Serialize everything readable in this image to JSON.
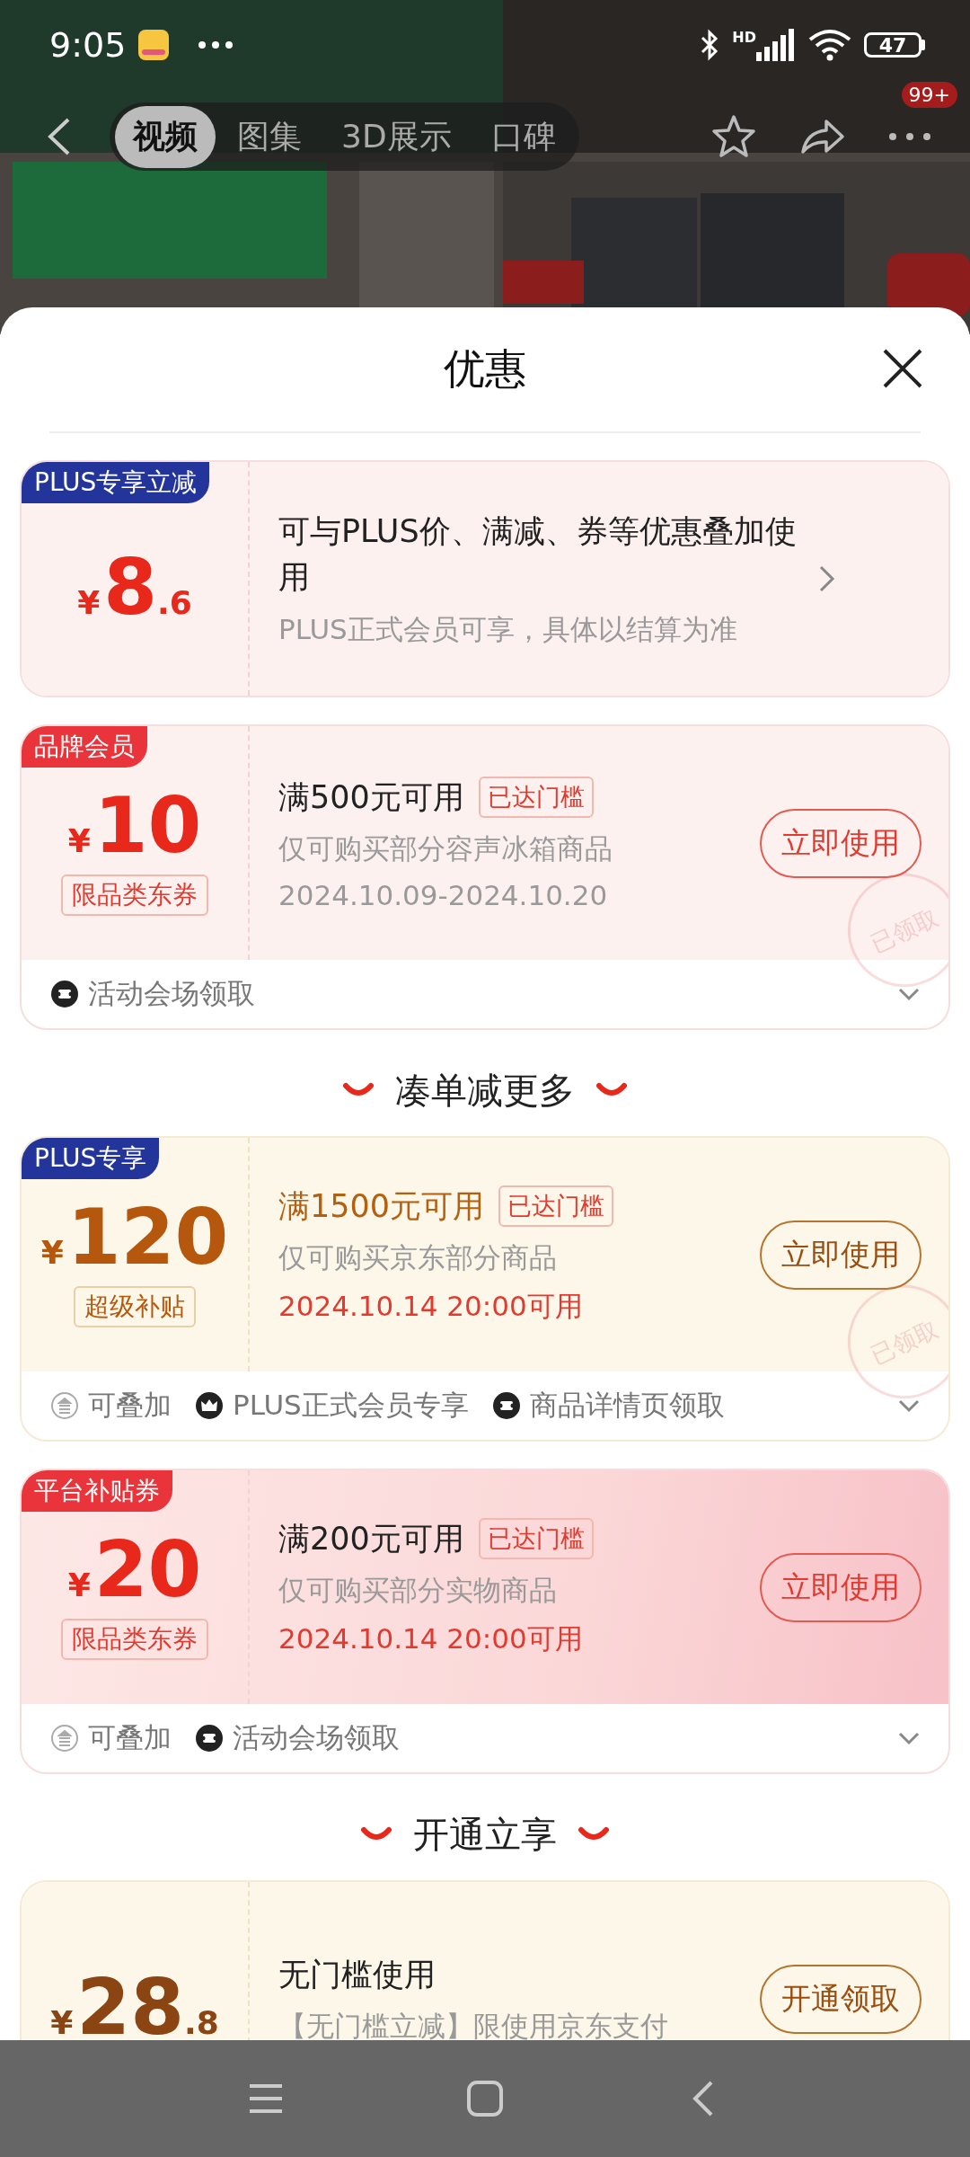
{
  "status_bar": {
    "time": "9:05",
    "network": "HD",
    "battery": "47"
  },
  "top_nav": {
    "tabs": [
      {
        "label": "视频",
        "selected": true
      },
      {
        "label": "图集",
        "selected": false
      },
      {
        "label": "3D展示",
        "selected": false
      },
      {
        "label": "口碑",
        "selected": false
      }
    ],
    "badge": "99+"
  },
  "sheet": {
    "title": "优惠"
  },
  "items": [
    {
      "kind": "info",
      "tag": "PLUS专享立减",
      "color": "#23359a",
      "currency": "¥",
      "amount": "8",
      "decimal": ".6",
      "title": "可与PLUS价、满减、券等优惠叠加使用",
      "desc": "PLUS正式会员可享，具体以结算为准"
    },
    {
      "kind": "coupon",
      "tag": "品牌会员",
      "color": "#e8343a",
      "currency": "¥",
      "amount": "10",
      "badge": "限品类东券",
      "title": "满500元可用",
      "threshold": "已达门槛",
      "desc": "仅可购买部分容声冰箱商品",
      "date": "2024.10.09-2024.10.20",
      "date_highlight": false,
      "button": "立即使用",
      "stamp": "已领取",
      "footer": [
        {
          "kind": "source",
          "text": "活动会场领取"
        }
      ]
    },
    {
      "kind": "heading",
      "text": "凑单减更多"
    },
    {
      "kind": "plus",
      "tag": "PLUS专享",
      "color": "#23359a",
      "currency": "¥",
      "amount": "120",
      "badge": "超级补贴",
      "title": "满1500元可用",
      "threshold": "已达门槛",
      "desc": "仅可购买京东部分商品",
      "date": "2024.10.14 20:00可用",
      "date_highlight": true,
      "button": "立即使用",
      "stamp": "已领取",
      "footer": [
        {
          "kind": "stackable",
          "text": "可叠加"
        },
        {
          "kind": "member",
          "text": "PLUS正式会员专享"
        },
        {
          "kind": "source",
          "text": "商品详情页领取"
        }
      ]
    },
    {
      "kind": "platform",
      "tag": "平台补贴券",
      "color": "#e8343a",
      "currency": "¥",
      "amount": "20",
      "badge": "限品类东券",
      "title": "满200元可用",
      "threshold": "已达门槛",
      "desc": "仅可购买部分实物商品",
      "date": "2024.10.14 20:00可用",
      "date_highlight": true,
      "button": "立即使用",
      "footer": [
        {
          "kind": "stackable",
          "text": "可叠加"
        },
        {
          "kind": "source",
          "text": "活动会场领取"
        }
      ]
    },
    {
      "kind": "heading",
      "text": "开通立享"
    },
    {
      "kind": "trial",
      "currency": "¥",
      "amount": "28",
      "decimal": ".8",
      "title": "无门槛使用",
      "desc": "【无门槛立减】限使用京东支付",
      "button": "开通领取"
    }
  ]
}
